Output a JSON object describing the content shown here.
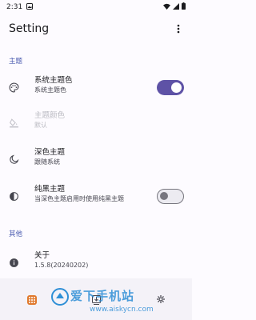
{
  "status_bar": {
    "time": "2:31"
  },
  "app_bar": {
    "title": "Setting"
  },
  "sections": {
    "theme": {
      "header": "主题"
    },
    "other": {
      "header": "其他"
    }
  },
  "prefs": {
    "system_theme": {
      "title": "系统主题色",
      "subtitle": "系统主题色",
      "enabled": true,
      "icon": "palette-icon"
    },
    "theme_color": {
      "title": "主题颜色",
      "subtitle": "默认",
      "icon": "format-color-fill-icon"
    },
    "dark_theme": {
      "title": "深色主题",
      "subtitle": "跟随系统",
      "icon": "dark-mode-icon"
    },
    "pure_black": {
      "title": "纯黑主题",
      "subtitle": "当深色主题启用时使用纯黑主题",
      "enabled": false,
      "icon": "contrast-icon"
    },
    "about": {
      "title": "关于",
      "subtitle": "1.5.8(20240202)",
      "icon": "info-icon"
    }
  },
  "watermark": {
    "text": "爱下手机站",
    "url": "www.aiskycn.com"
  },
  "colors": {
    "accent": "#5e52a6",
    "section_header": "#4a5bb0",
    "background": "#fdfbff"
  }
}
